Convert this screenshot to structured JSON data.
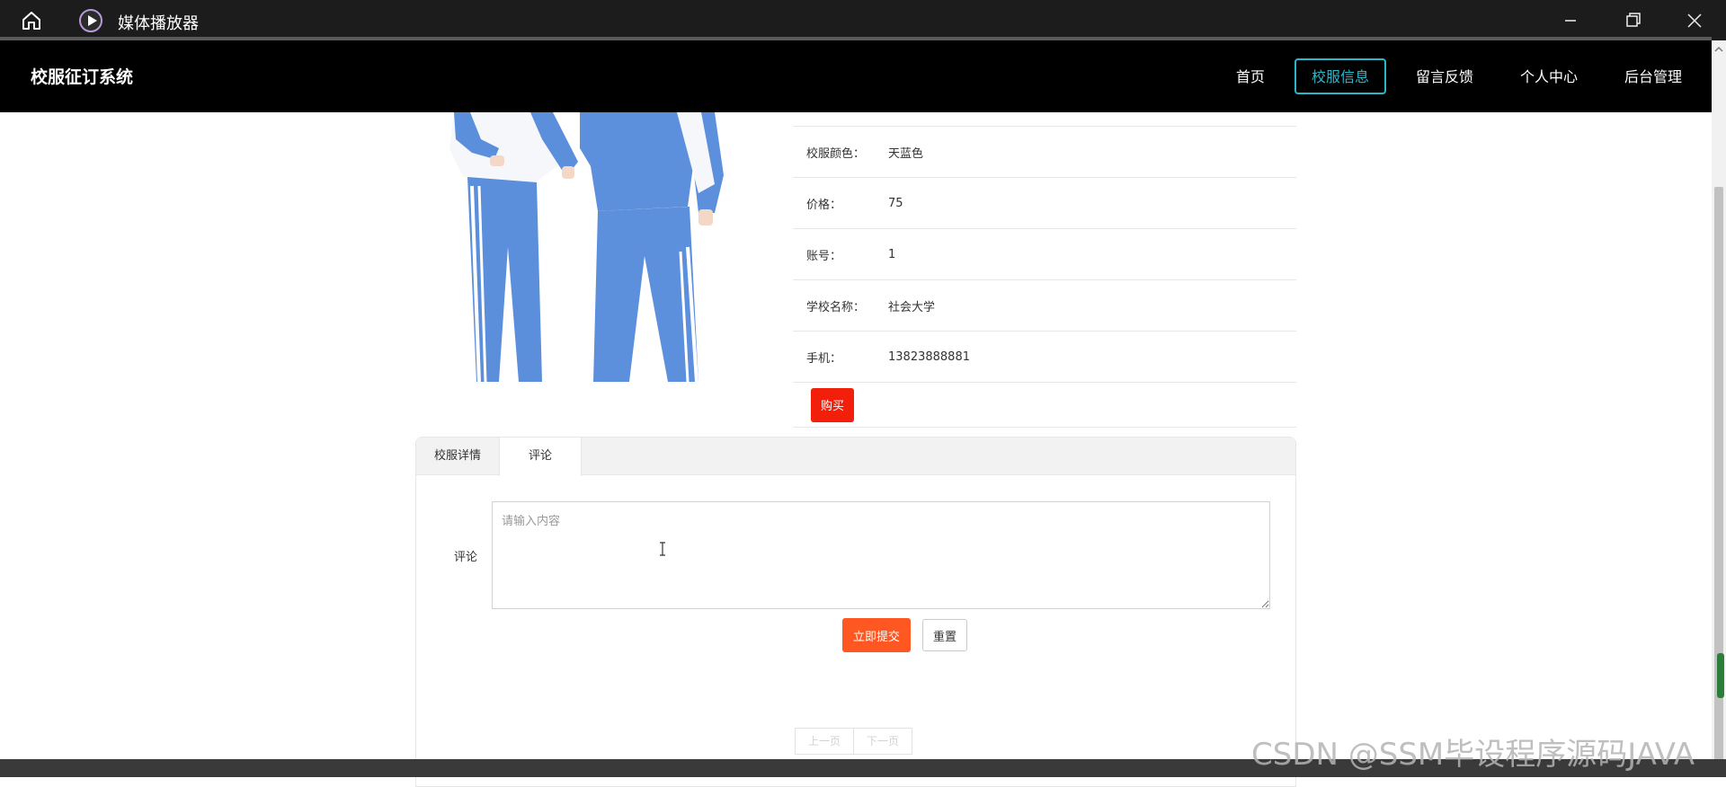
{
  "player": {
    "title": "媒体播放器",
    "home_icon": "home-icon",
    "app_icon": "media-player-icon"
  },
  "site": {
    "logo": "校服征订系统",
    "nav": [
      {
        "label": "首页"
      },
      {
        "label": "校服信息"
      },
      {
        "label": "留言反馈"
      },
      {
        "label": "个人中心"
      },
      {
        "label": "后台管理"
      }
    ]
  },
  "product": {
    "fields": [
      {
        "label": "校服颜色：",
        "value": "天蓝色"
      },
      {
        "label": "价格：",
        "value": "75"
      },
      {
        "label": "账号：",
        "value": "1"
      },
      {
        "label": "学校名称：",
        "value": "社会大学"
      },
      {
        "label": "手机：",
        "value": "13823888881"
      }
    ],
    "buy_label": "购买"
  },
  "tabs": [
    {
      "label": "校服详情"
    },
    {
      "label": "评论"
    }
  ],
  "comment": {
    "label": "评论",
    "placeholder": "请输入内容",
    "submit_label": "立即提交",
    "reset_label": "重置"
  },
  "pager": {
    "prev_label": "上一页",
    "next_label": "下一页"
  },
  "watermark": "CSDN @SSM毕设程序源码JAVA",
  "colors": {
    "accent_nav": "#2ab7c9",
    "buy": "#f21f0b",
    "submit": "#ff5722",
    "header_bg": "#000000"
  }
}
